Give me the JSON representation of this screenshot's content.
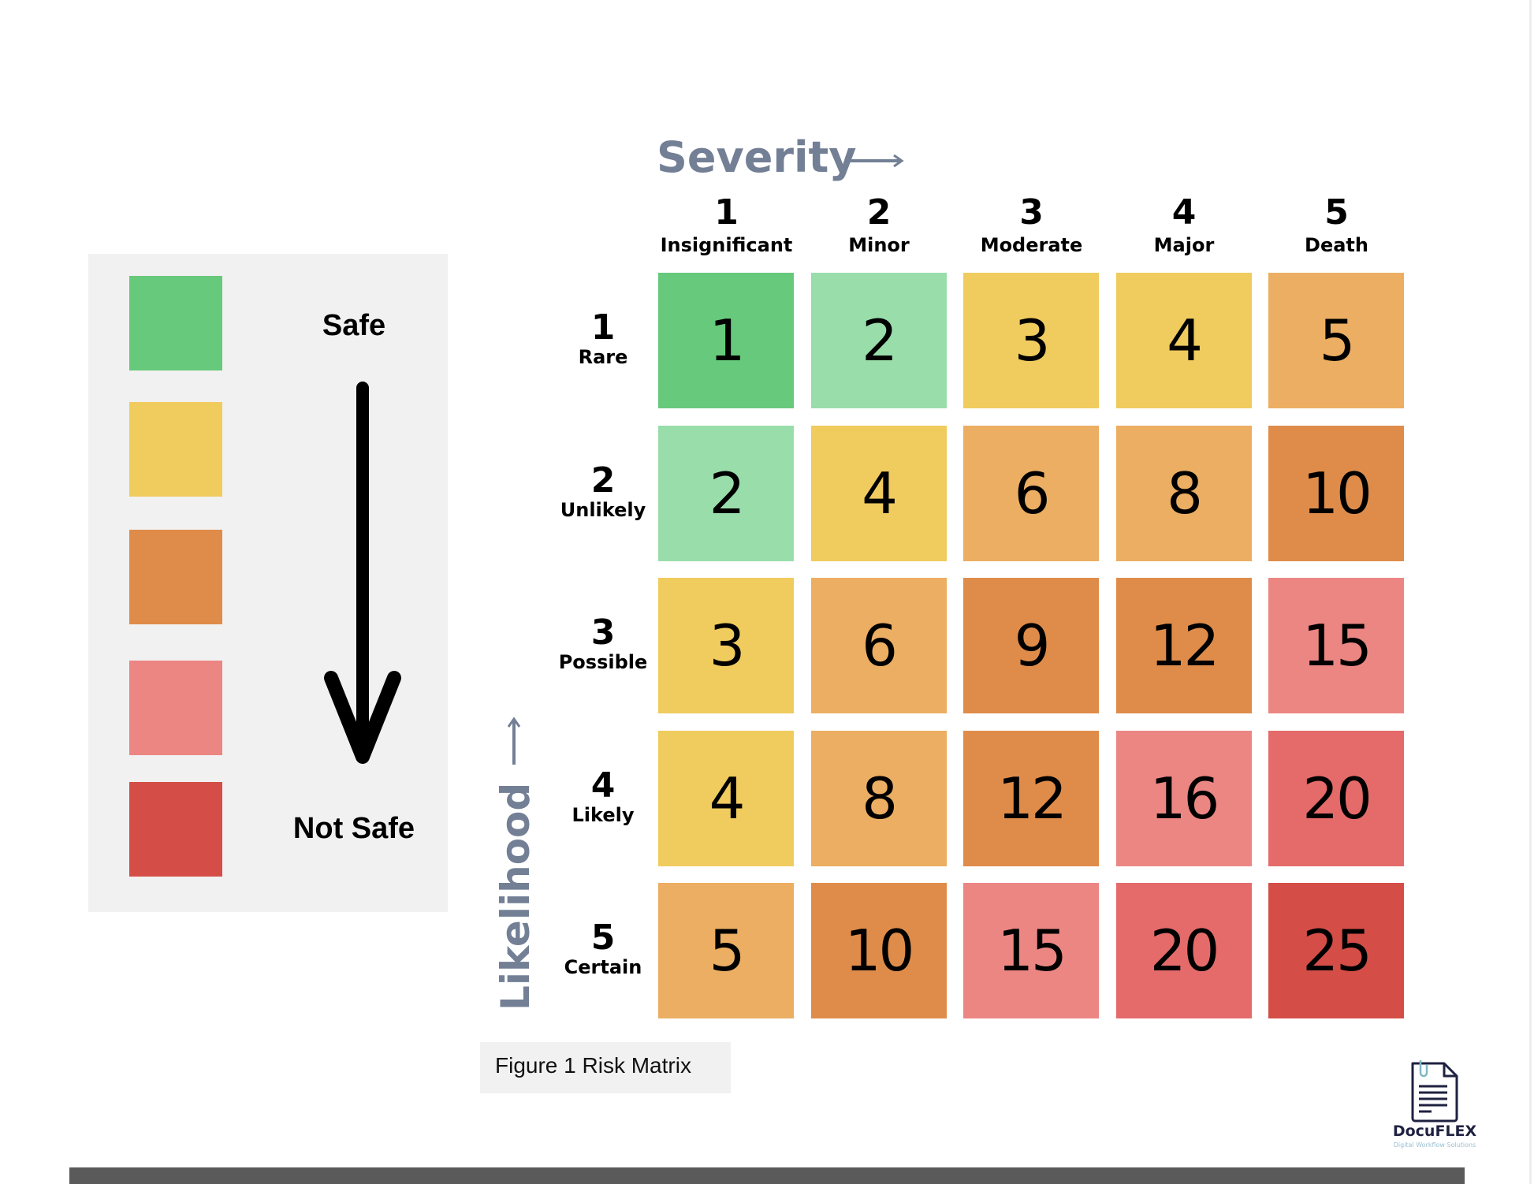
{
  "figure": {
    "caption": "Figure 1 Risk Matrix"
  },
  "legend": {
    "top_label": "Safe",
    "bottom_label": "Not Safe",
    "swatches": [
      {
        "name": "safe",
        "color": "#66C97B"
      },
      {
        "name": "low",
        "color": "#F0CB5E"
      },
      {
        "name": "medium",
        "color": "#DF8C4A"
      },
      {
        "name": "high",
        "color": "#EB8683"
      },
      {
        "name": "not-safe",
        "color": "#D44E47"
      }
    ]
  },
  "logo": {
    "brand": "DocuFLEX",
    "tagline": "Digital Workflow Solutions"
  },
  "chart_data": {
    "type": "heatmap",
    "title": "Risk Matrix",
    "xlabel": "Severity",
    "ylabel": "Likelihood",
    "columns": [
      {
        "num": "1",
        "name": "Insignificant"
      },
      {
        "num": "2",
        "name": "Minor"
      },
      {
        "num": "3",
        "name": "Moderate"
      },
      {
        "num": "4",
        "name": "Major"
      },
      {
        "num": "5",
        "name": "Death"
      }
    ],
    "rows": [
      {
        "num": "1",
        "name": "Rare"
      },
      {
        "num": "2",
        "name": "Unlikely"
      },
      {
        "num": "3",
        "name": "Possible"
      },
      {
        "num": "4",
        "name": "Likely"
      },
      {
        "num": "5",
        "name": "Certain"
      }
    ],
    "values": [
      [
        1,
        2,
        3,
        4,
        5
      ],
      [
        2,
        4,
        6,
        8,
        10
      ],
      [
        3,
        6,
        9,
        12,
        15
      ],
      [
        4,
        8,
        12,
        16,
        20
      ],
      [
        5,
        10,
        15,
        20,
        25
      ]
    ],
    "colors": [
      [
        "#66C97B",
        "#98DDAA",
        "#F0CB5E",
        "#F0CB5E",
        "#EBAE62"
      ],
      [
        "#98DDAA",
        "#F0CB5E",
        "#EBAE62",
        "#EBAE62",
        "#DF8C4A"
      ],
      [
        "#F0CB5E",
        "#EBAE62",
        "#DF8C4A",
        "#DF8C4A",
        "#EB8683"
      ],
      [
        "#F0CB5E",
        "#EBAE62",
        "#DF8C4A",
        "#EB8683",
        "#E46B6A"
      ],
      [
        "#EBAE62",
        "#DF8C4A",
        "#EB8683",
        "#E46B6A",
        "#D44E47"
      ]
    ]
  }
}
